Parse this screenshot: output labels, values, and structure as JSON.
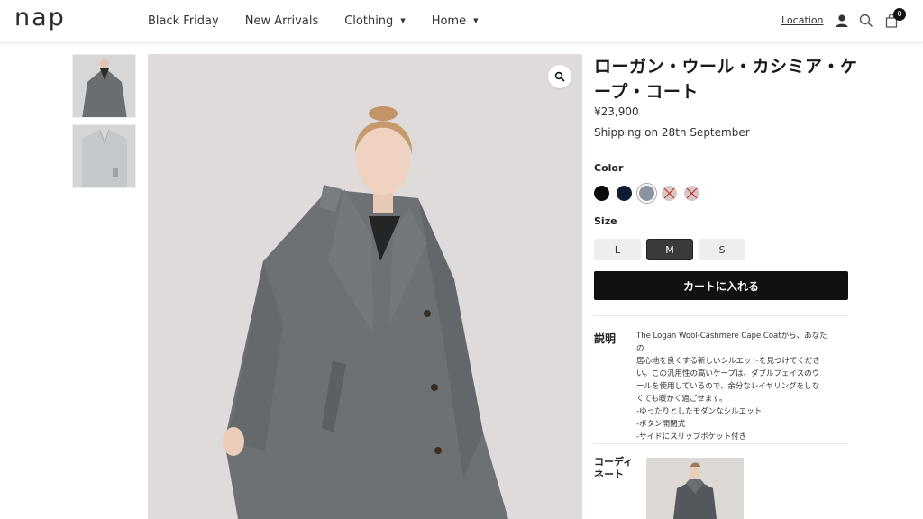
{
  "header": {
    "logo": "nap",
    "nav": [
      {
        "label": "Black Friday",
        "has_dropdown": false
      },
      {
        "label": "New Arrivals",
        "has_dropdown": false
      },
      {
        "label": "Clothing",
        "has_dropdown": true
      },
      {
        "label": "Home",
        "has_dropdown": true
      }
    ],
    "location_label": "Location",
    "icons": [
      "user-icon",
      "search-icon",
      "cart-icon"
    ],
    "cart_count": "0"
  },
  "product": {
    "title": "ローガン・ウール・カシミア・ケープ・コート",
    "price": "¥23,900",
    "shipping": "Shipping on 28th September",
    "color_label": "Color",
    "colors": [
      {
        "hex": "#0b0b0b",
        "available": true,
        "selected": false
      },
      {
        "hex": "#101c33",
        "available": true,
        "selected": false
      },
      {
        "hex": "#8a939e",
        "available": true,
        "selected": true
      },
      {
        "hex": "#d9c9c4",
        "available": false,
        "selected": false
      },
      {
        "hex": "#d8c4c9",
        "available": false,
        "selected": false
      }
    ],
    "size_label": "Size",
    "sizes": [
      {
        "label": "L",
        "selected": false
      },
      {
        "label": "M",
        "selected": true
      },
      {
        "label": "S",
        "selected": false
      }
    ],
    "add_to_cart": "カートに入れる",
    "description_label": "説明",
    "description_lines": [
      "The Logan Wool-Cashmere Cape Coatから、あなたの",
      "居心地を良くする新しいシルエットを見つけてくださ",
      "い。この汎用性の高いケープは、ダブルフェイスのウ",
      "ールを使用しているので、余分なレイヤリングをしな",
      "くても暖かく過ごせます。",
      "-ゆったりとしたモダンなシルエット",
      "-ボタン開閉式",
      "-サイドにスリップポケット付き"
    ],
    "coordinate_label": "コーディネート"
  },
  "colors": {
    "accent": "#111111",
    "coat": "#6d7071",
    "background_photo": "#dcd9d8"
  }
}
